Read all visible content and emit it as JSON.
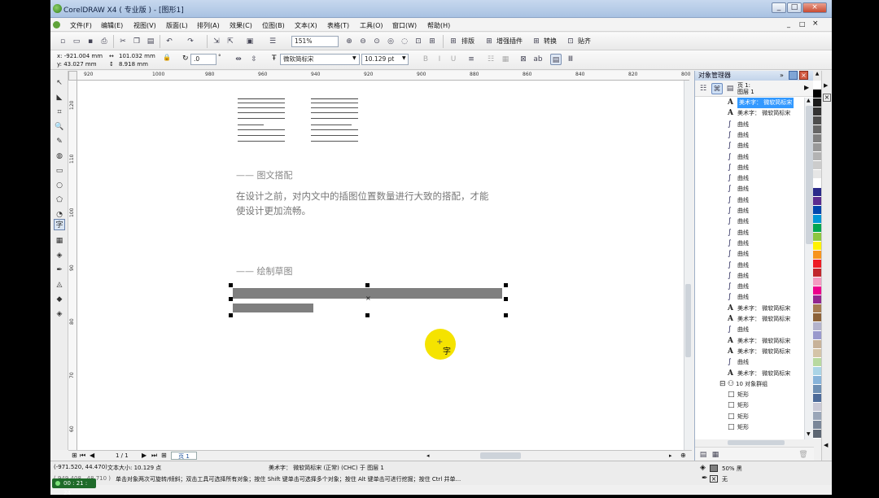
{
  "window": {
    "title": "CorelDRAW X4 ( 专业版 ) - [图形1]",
    "controls": [
      "_",
      "□",
      "×"
    ],
    "inner_controls": [
      "_",
      "□",
      "×"
    ]
  },
  "menubar": [
    "文件(F)",
    "编辑(E)",
    "视图(V)",
    "版面(L)",
    "排列(A)",
    "效果(C)",
    "位图(B)",
    "文本(X)",
    "表格(T)",
    "工具(O)",
    "窗口(W)",
    "帮助(H)"
  ],
  "toolbar": {
    "zoom": "151%",
    "buttons": [
      "排版",
      "增强插件",
      "转换",
      "贴齐"
    ]
  },
  "propbar": {
    "x": "x: -921.004 mm",
    "y": "y: 43.027 mm",
    "w": "101.032 mm",
    "h": "8.918 mm",
    "angle": ".0",
    "angle_unit": "°",
    "font": "微软简标宋",
    "font_size": "10.129 pt"
  },
  "ruler": {
    "h": [
      "920",
      "1000",
      "980",
      "960",
      "940",
      "920",
      "900",
      "880",
      "860",
      "840",
      "820",
      "800"
    ],
    "v": [
      "120",
      "110",
      "100",
      "90",
      "80",
      "70",
      "60",
      "50",
      "40"
    ]
  },
  "document": {
    "heading1": "—— 图文搭配",
    "para1_line1": "在设计之前，对内文中的插图位置数量进行大致的搭配，才能",
    "para1_line2": "使设计更加流畅。",
    "heading2": "—— 绘制草图",
    "cursor_glyph": "字"
  },
  "docker": {
    "title": "对象管理器",
    "page_label": "页 1:",
    "layer_label": "图层 1",
    "items": [
      {
        "icon": "A",
        "label": "美术字：  微软简标宋",
        "selected": true
      },
      {
        "icon": "A",
        "label": "美术字：  微软简标宋"
      },
      {
        "icon": "∫",
        "label": "曲线"
      },
      {
        "icon": "∫",
        "label": "曲线"
      },
      {
        "icon": "∫",
        "label": "曲线"
      },
      {
        "icon": "∫",
        "label": "曲线"
      },
      {
        "icon": "∫",
        "label": "曲线"
      },
      {
        "icon": "∫",
        "label": "曲线"
      },
      {
        "icon": "∫",
        "label": "曲线"
      },
      {
        "icon": "∫",
        "label": "曲线"
      },
      {
        "icon": "∫",
        "label": "曲线"
      },
      {
        "icon": "∫",
        "label": "曲线"
      },
      {
        "icon": "∫",
        "label": "曲线"
      },
      {
        "icon": "∫",
        "label": "曲线"
      },
      {
        "icon": "∫",
        "label": "曲线"
      },
      {
        "icon": "∫",
        "label": "曲线"
      },
      {
        "icon": "∫",
        "label": "曲线"
      },
      {
        "icon": "∫",
        "label": "曲线"
      },
      {
        "icon": "∫",
        "label": "曲线"
      },
      {
        "icon": "A",
        "label": "美术字：  微软简标宋"
      },
      {
        "icon": "A",
        "label": "美术字：  微软简标宋"
      },
      {
        "icon": "∫",
        "label": "曲线"
      },
      {
        "icon": "A",
        "label": "美术字：  微软简标宋"
      },
      {
        "icon": "A",
        "label": "美术字：  微软简标宋"
      },
      {
        "icon": "∫",
        "label": "曲线"
      },
      {
        "icon": "A",
        "label": "美术字：  微软简标宋"
      },
      {
        "icon": "⊟",
        "label": "10 对象群组"
      },
      {
        "icon": "□",
        "label": "矩形"
      },
      {
        "icon": "□",
        "label": "矩形"
      },
      {
        "icon": "□",
        "label": "矩形"
      },
      {
        "icon": "□",
        "label": "矩形"
      }
    ]
  },
  "pagenav": {
    "count": "1 / 1",
    "tab": "页 1"
  },
  "status": {
    "coords": "(-971.520, 44.470)",
    "size": "文本大小: 10.129 点",
    "object": "美术字：  微软简标宋 (正常) (CHC) 于 图层 1",
    "hint": "单击对象两次可旋转/倾斜；双击工具可选择所有对象；按住 Shift 键单击可选择多个对象；按住 Alt 键单击可进行挖掘；按住 Ctrl 并单...",
    "coords2": "( 949.408 , 48.710 )",
    "fill": "50% 黑",
    "outline": "无"
  },
  "recorder": {
    "time": "00 : 21 : 24"
  },
  "palette": [
    "#ffffff",
    "#000000",
    "#1a1a1a",
    "#333333",
    "#4d4d4d",
    "#666666",
    "#808080",
    "#999999",
    "#b3b3b3",
    "#cccccc",
    "#e6e6e6",
    "#ffffff",
    "#2a2a8a",
    "#5b2c8f",
    "#0046ad",
    "#0096d6",
    "#00a651",
    "#8dc63f",
    "#fff200",
    "#f7941d",
    "#ed1c24",
    "#c1272d",
    "#f49ac1",
    "#ec008c",
    "#92278f",
    "#a67c52",
    "#8c6239",
    "#b3b3cc",
    "#9999cc",
    "#c7b299",
    "#d4c4a8",
    "#b8d9a0",
    "#aad4e6",
    "#87b3d9",
    "#6e8fb3",
    "#4d6b99",
    "#c9c9d6",
    "#9aa6b8",
    "#7a8799",
    "#5c6673"
  ],
  "colors": {
    "selection": "#3399ff",
    "highlight": "#f5e300",
    "sketch_bar": "#7f7f7f"
  }
}
